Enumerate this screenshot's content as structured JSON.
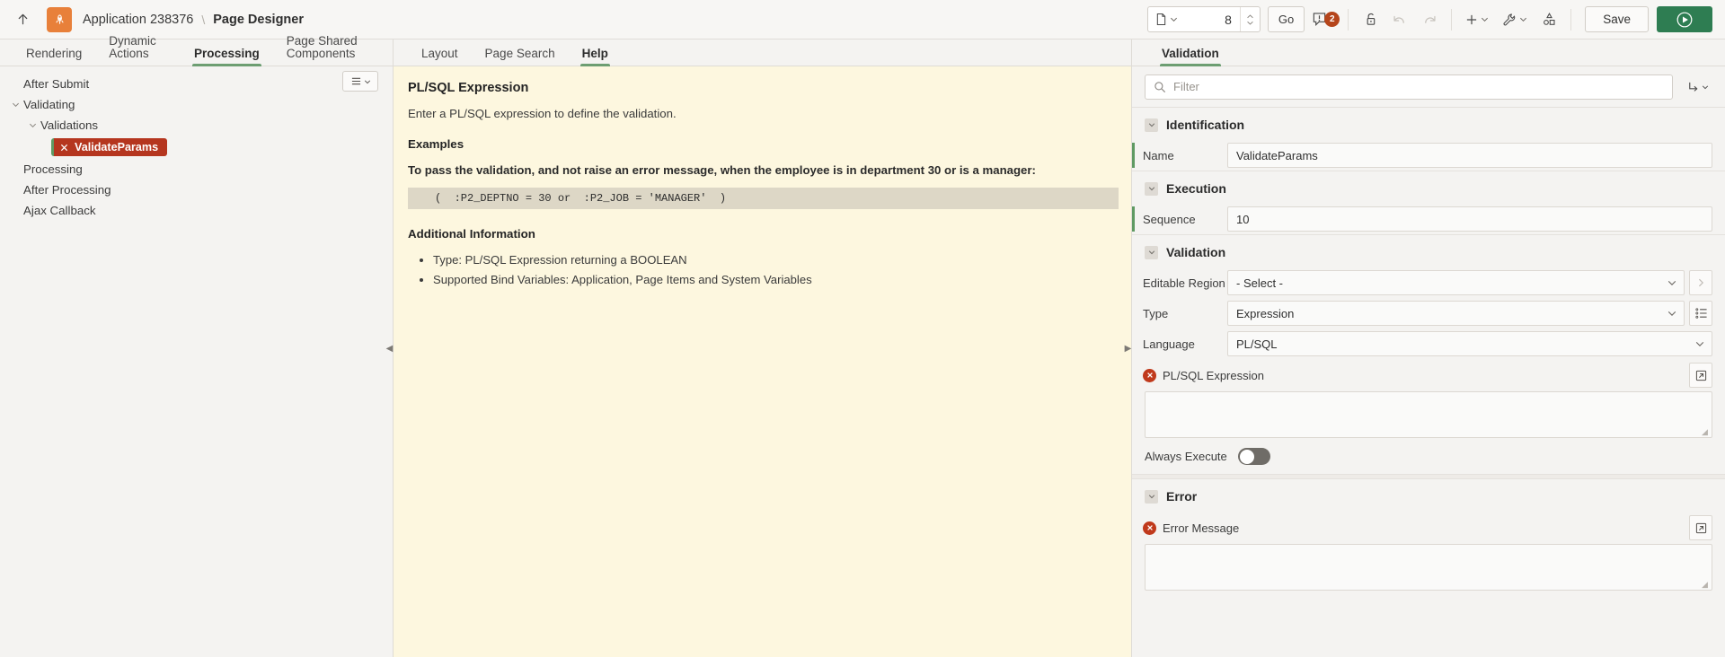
{
  "topbar": {
    "up_icon": "arrow-up-icon",
    "app_logo_icon": "oracle-apex-logo",
    "breadcrumb_app": "Application 238376",
    "breadcrumb_sep": "\\",
    "breadcrumb_current": "Page Designer",
    "page_type_icon": "page-icon",
    "page_number": "8",
    "go_label": "Go",
    "warning_icon": "warning-comment-icon",
    "warning_count": "2",
    "lock_icon": "unlock-icon",
    "undo_icon": "undo-icon",
    "redo_icon": "redo-icon",
    "add_icon": "plus-icon",
    "utilities_icon": "wrench-icon",
    "components_icon": "page-components-icon",
    "save_label": "Save",
    "run_icon": "run-play-icon"
  },
  "left": {
    "tabs": [
      {
        "label": "Rendering",
        "active": false
      },
      {
        "label": "Dynamic Actions",
        "active": false
      },
      {
        "label": "Processing",
        "active": true
      },
      {
        "label": "Page Shared Components",
        "active": false
      }
    ],
    "menu_icon": "hamburger-menu-icon",
    "tree": [
      {
        "label": "After Submit",
        "indent": 1,
        "twisty": "",
        "type": "node"
      },
      {
        "label": "Validating",
        "indent": 0,
        "twisty": "chevron-down-icon",
        "type": "node"
      },
      {
        "label": "Validations",
        "indent": 1,
        "twisty": "chevron-down-icon",
        "type": "node"
      },
      {
        "label": "ValidateParams",
        "indent": 2,
        "twisty": "",
        "type": "chip",
        "chip_icon": "x-close-icon"
      },
      {
        "label": "Processing",
        "indent": 1,
        "twisty": "",
        "type": "node"
      },
      {
        "label": "After Processing",
        "indent": 1,
        "twisty": "",
        "type": "node"
      },
      {
        "label": "Ajax Callback",
        "indent": 1,
        "twisty": "",
        "type": "node"
      }
    ],
    "splitter_icon": "collapse-left-icon"
  },
  "center": {
    "tabs": [
      {
        "label": "Layout",
        "active": false
      },
      {
        "label": "Page Search",
        "active": false
      },
      {
        "label": "Help",
        "active": true
      }
    ],
    "help": {
      "title": "PL/SQL Expression",
      "intro": "Enter a PL/SQL expression to define the validation.",
      "examples_heading": "Examples",
      "example_desc": "To pass the validation, and not raise an error message, when the employee is in department 30 or is a manager:",
      "example_code": "(  :P2_DEPTNO = 30 or  :P2_JOB = 'MANAGER'  )",
      "additional_heading": "Additional Information",
      "additional_items": [
        "Type: PL/SQL Expression returning a BOOLEAN",
        "Supported Bind Variables: Application, Page Items and System Variables"
      ]
    },
    "splitter_icon": "collapse-right-icon"
  },
  "right": {
    "tabs": [
      {
        "label": "Validation",
        "active": true
      }
    ],
    "search_icon": "search-icon",
    "filter_placeholder": "Filter",
    "filter_value": "",
    "goto_icon": "goto-group-icon",
    "goto_caret_icon": "chevron-down-icon",
    "sections": {
      "identification": {
        "title": "Identification",
        "toggle_icon": "chevron-down-icon",
        "name_label": "Name",
        "name_value": "ValidateParams"
      },
      "execution": {
        "title": "Execution",
        "toggle_icon": "chevron-down-icon",
        "sequence_label": "Sequence",
        "sequence_value": "10"
      },
      "validation": {
        "title": "Validation",
        "toggle_icon": "chevron-down-icon",
        "editable_region_label": "Editable Region",
        "editable_region_value": "- Select -",
        "editable_region_next_icon": "chevron-right-icon",
        "type_label": "Type",
        "type_value": "Expression",
        "type_list_icon": "list-picker-icon",
        "language_label": "Language",
        "language_value": "PL/SQL",
        "plsql_expression_label": "PL/SQL Expression",
        "plsql_expression_value": "",
        "plsql_expand_icon": "expand-editor-icon",
        "plsql_error_icon": "error-required-icon",
        "always_execute_label": "Always Execute",
        "always_execute_state": "off"
      },
      "error": {
        "title": "Error",
        "toggle_icon": "chevron-down-icon",
        "error_message_label": "Error Message",
        "error_message_value": "",
        "error_message_expand_icon": "expand-editor-icon",
        "error_message_error_icon": "error-required-icon"
      }
    }
  },
  "colors": {
    "accent_green": "#2e7d52",
    "tab_underline": "#6d9e72",
    "chip_red": "#b5361f",
    "logo_orange": "#e8803a",
    "help_bg": "#fdf7df",
    "badge_red": "#b5451b"
  }
}
